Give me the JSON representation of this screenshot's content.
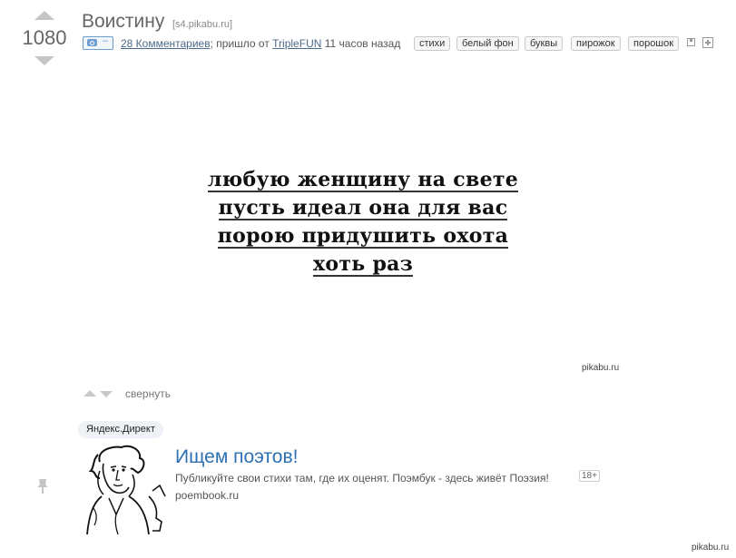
{
  "post": {
    "rating": "1080",
    "title": "Воистину",
    "source": "[s4.pikabu.ru]",
    "badge_dash": "–",
    "comments": "28 Комментариев",
    "came_from": "; пришло от ",
    "author": "TripleFUN",
    "time": " 11 часов назад",
    "tags": [
      "стихи",
      "белый фон",
      "буквы",
      "пирожок",
      "порошок"
    ]
  },
  "image": {
    "lines": [
      "любую женщину на свете",
      "пусть идеал она для вас",
      "порою придушить охота",
      "хоть раз"
    ],
    "watermark": "pikabu.ru"
  },
  "controls": {
    "collapse": "свернуть"
  },
  "ad": {
    "label": "Яндекс.Директ",
    "title": "Ищем поэтов!",
    "text": "Публикуйте свои стихи там, где их оценят. Поэмбук - здесь живёт Поэзия!",
    "age": "18+",
    "domain": "poembook.ru"
  },
  "footer": {
    "watermark": "pikabu.ru"
  },
  "colors": {
    "link_blue": "#2c6fb2",
    "arrow_gray": "#c5c5c5",
    "badge_border": "#6a9bd1"
  },
  "icons": [
    "vote-up-icon",
    "vote-down-icon",
    "camera-icon",
    "save-icon",
    "plus-icon",
    "pin-icon",
    "portrait-image"
  ]
}
